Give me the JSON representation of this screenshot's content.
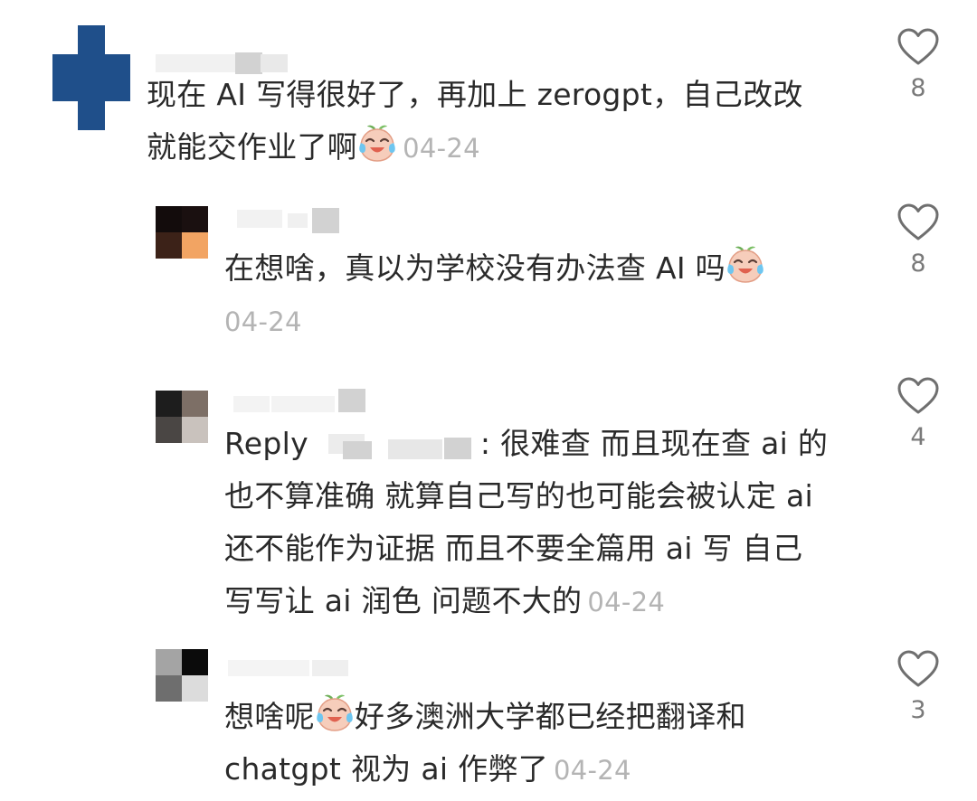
{
  "comments": [
    {
      "text": "现在AI写得很好了，再加上zerogpt，自己改改就能交作业了啊",
      "line1": "现在 AI 写得很好了，再加上 zerogpt，自己改改",
      "line2": "就能交作业了啊",
      "emoji": "crying-laughing-peach-emoji",
      "date": "04-24",
      "likes": "8"
    },
    {
      "line1": "在想啥，真以为学校没有办法查 AI 吗",
      "emoji": "crying-laughing-peach-emoji",
      "date": "04-24",
      "likes": "8"
    },
    {
      "reply_prefix": "Reply",
      "line1": ": 很难查 而且现在查 ai 的",
      "line2": "也不算准确 就算自己写的也可能会被认定 ai",
      "line3": "还不能作为证据 而且不要全篇用 ai 写 自己",
      "line4": "写写让 ai 润色 问题不大的",
      "date": "04-24",
      "likes": "4"
    },
    {
      "line1a": "想啥呢",
      "emoji": "crying-laughing-peach-emoji",
      "line1b": "好多澳洲大学都已经把翻译和",
      "line2": "chatgpt 视为 ai 作弊了",
      "date": "04-24",
      "likes": "3"
    }
  ],
  "colors": {
    "avatar_main": "#1f4f8a",
    "date": "#b4b4b4",
    "count": "#7a7a7a"
  }
}
